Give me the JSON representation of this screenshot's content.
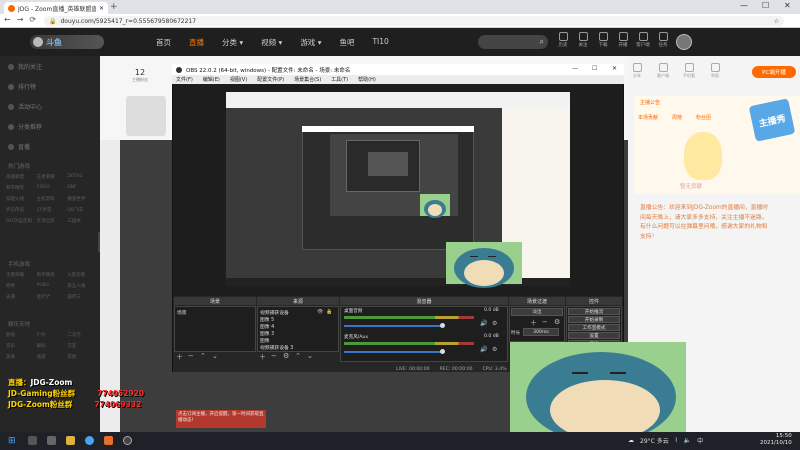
{
  "browser": {
    "tab_title": "JDG - Zoom直播_英雄联盟直播",
    "new_tab": "+",
    "url": "douyu.com/5925417_r=0.555679580672217",
    "minimize": "—",
    "maximize": "☐",
    "close": "✕",
    "back": "←",
    "forward": "→",
    "reload": "⟳"
  },
  "douyu": {
    "logo_text": "斗鱼",
    "nav": [
      "首页",
      "直播",
      "分类 ▾",
      "视频 ▾",
      "游戏 ▾",
      "鱼吧",
      "TI10"
    ],
    "header_icons": [
      "历史",
      "关注",
      "下载",
      "开播",
      "客户端",
      "任务"
    ],
    "fans_count": "12",
    "fans_label": "主播粉丝"
  },
  "sidebar": {
    "items": [
      "我的关注",
      "排行榜",
      "活动中心",
      "分类推荐",
      "直播"
    ],
    "section_hot": "热门游戏",
    "hot_games": [
      "英雄联盟",
      "王者荣耀",
      "DOTA2",
      "和平精英",
      "CSGO",
      "DNF",
      "穿越火线",
      "主机游戏",
      "魔兽世界",
      "炉石传说",
      "CF手游",
      "QQ飞车",
      "DOTA自走棋",
      "云顶之弈",
      "三国杀"
    ],
    "section_mobile": "手机游戏",
    "mobile_games": [
      "王者荣耀",
      "和平精英",
      "火影忍者",
      "原神",
      "PUBG",
      "第五人格",
      "光遇",
      "金铲铲",
      "崩坏三"
    ],
    "section_more": "娱乐天地",
    "more_games": [
      "颜值",
      "户外",
      "二次元",
      "音乐",
      "舞蹈",
      "交友",
      "美食",
      "旅游",
      "其他"
    ]
  },
  "right_panel": {
    "pc_button": "PC端开播",
    "icons": [
      "分享",
      "客户端",
      "手机看",
      "举报"
    ],
    "title_strip": "主播公告",
    "tabs": [
      "本场贡献",
      "周榜",
      "粉丝团"
    ],
    "mascot_caption": "暂无贡献",
    "sticker_text": "主播秀",
    "announcement": "直播公告：欢迎来到JDG-Zoom的直播间，直播时间每天晚上，请大家多多支持，关注主播不迷路，有什么问题可以在弹幕里问哦，感谢大家的礼物和支持！"
  },
  "obs": {
    "title": "OBS 22.0.2 (64-bit, windows) - 配置文件: 未命名 - 场景: 未命名",
    "menu": [
      "文件(F)",
      "编辑(E)",
      "视图(V)",
      "配置文件(P)",
      "场景集合(S)",
      "工具(T)",
      "帮助(H)"
    ],
    "docks": {
      "scenes": "场景",
      "sources": "来源",
      "mixer": "混音器",
      "transitions": "场景过渡",
      "controls": "控件"
    },
    "scene_list": [
      "场景"
    ],
    "sources_list": [
      "视频捕获设备",
      "图像 5",
      "图像 4",
      "图像 3",
      "图像",
      "视频捕获设备 3",
      "媒体源"
    ],
    "mixer_tracks": [
      {
        "name": "桌面音频",
        "db": "0.0 dB"
      },
      {
        "name": "麦克风/Aux",
        "db": "0.0 dB"
      }
    ],
    "transition": {
      "type": "淡出",
      "duration_label": "时长",
      "duration": "300ms"
    },
    "controls": [
      "开始推流",
      "开始录制",
      "工作室模式",
      "设置",
      "退出"
    ],
    "status": [
      "LIVE: 00:00:00",
      "REC: 00:00:00",
      "CPU: 3.4%"
    ]
  },
  "overlay": {
    "line1_label": "直播：",
    "line1_value": "JDG-Zoom",
    "line2_label": "JD-Gaming粉丝群",
    "line2_value": "774052920",
    "line3_label": "JDG-Zoom粉丝群",
    "line3_value": "774069332",
    "red_box": "点击订阅主播，开启提醒，第一时间获取直播动态！"
  },
  "taskbar": {
    "start": "⊞",
    "weather": "29°C 多云",
    "lang": "中",
    "time": "15:50",
    "date": "2021/10/10"
  }
}
